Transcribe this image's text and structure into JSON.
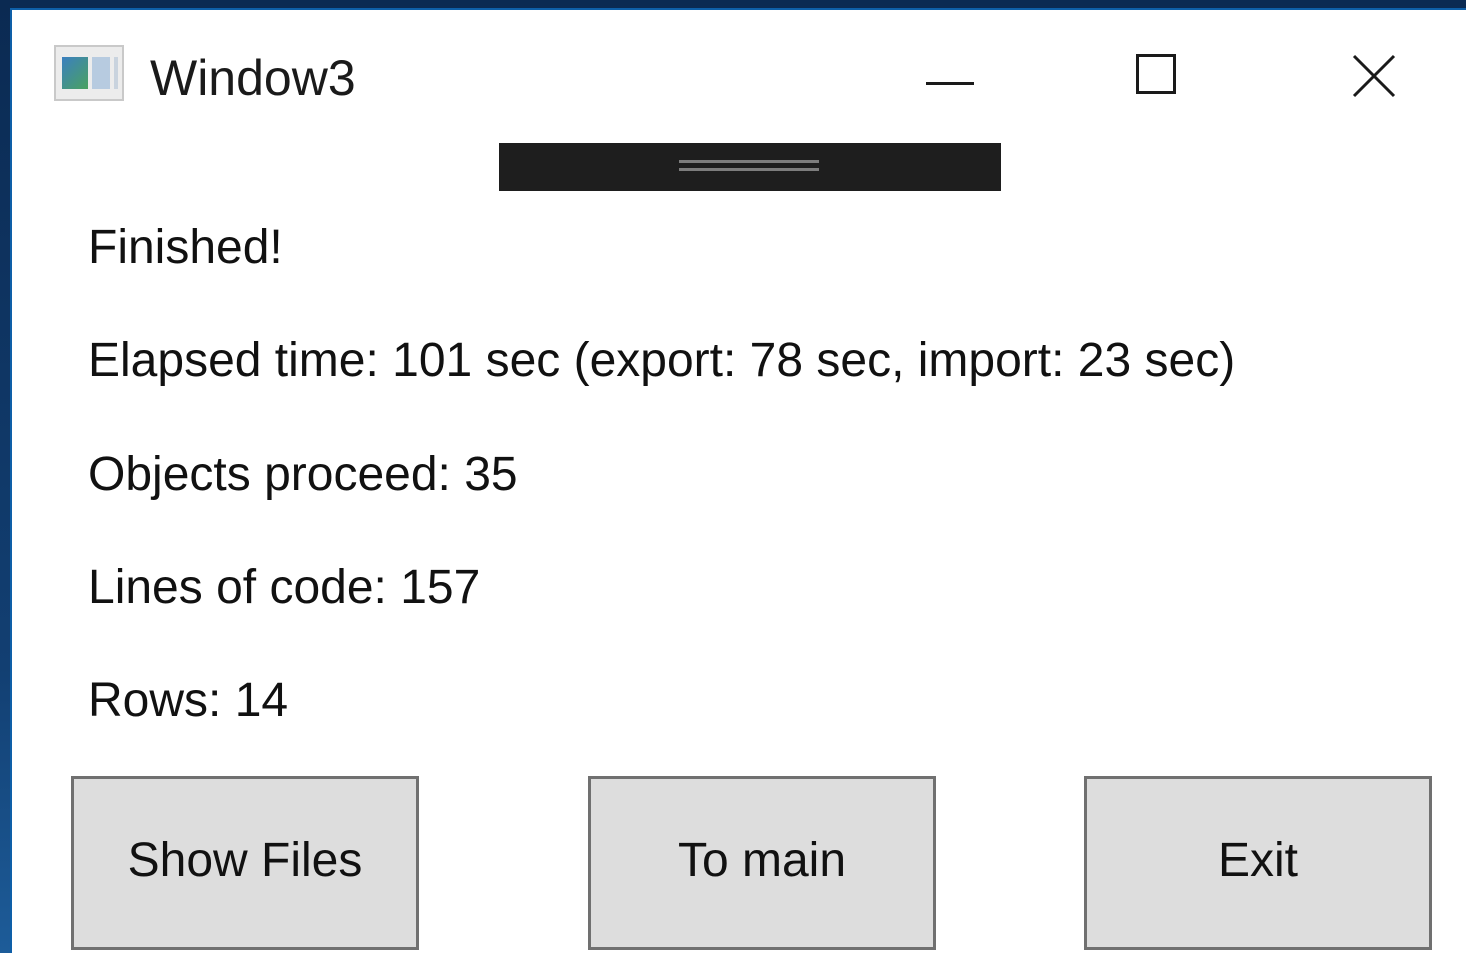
{
  "window": {
    "title": "Window3",
    "icon": "app-window-icon",
    "controls": {
      "minimize": "minimize-icon",
      "maximize": "maximize-icon",
      "close": "close-icon"
    }
  },
  "status": {
    "message": "Finished!",
    "elapsed": "Elapsed time: 101 sec (export: 78 sec, import: 23 sec)",
    "objects": "Objects proceed: 35",
    "lines_of_code": "Lines of code: 157",
    "rows": "Rows: 14"
  },
  "buttons": {
    "show_files": "Show Files",
    "to_main": "To main",
    "exit": "Exit"
  },
  "colors": {
    "desktop": "#123f72",
    "window_border": "#0e5fa8",
    "drag_bar": "#1e1e1e",
    "button_face": "#dddddd",
    "button_border": "#707070"
  }
}
